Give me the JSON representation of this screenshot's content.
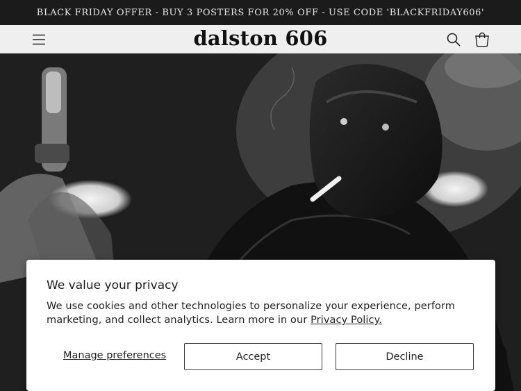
{
  "announcement": {
    "text": "BLACK FRIDAY OFFER - BUY 3 POSTERS FOR 20% OFF - USE CODE 'BLACKFRIDAY606'"
  },
  "header": {
    "logo": "dalston 606",
    "menu_icon": "hamburger-menu-icon",
    "search_icon": "search-icon",
    "cart_icon": "shopping-bag-icon"
  },
  "hero": {
    "image": "black-and-white photograph of a musician smoking a cigarette next to a studio microphone"
  },
  "cookie_banner": {
    "title": "We value your privacy",
    "body": "We use cookies and other technologies to personalize your experience, perform marketing, and collect analytics. Learn more in our ",
    "policy_link": "Privacy Policy.",
    "manage_label": "Manage preferences",
    "accept_label": "Accept",
    "decline_label": "Decline"
  },
  "colors": {
    "announcement_bg": "#1b1b1b",
    "header_bg": "#efefef",
    "banner_bg": "#ffffff",
    "text": "#222222"
  }
}
